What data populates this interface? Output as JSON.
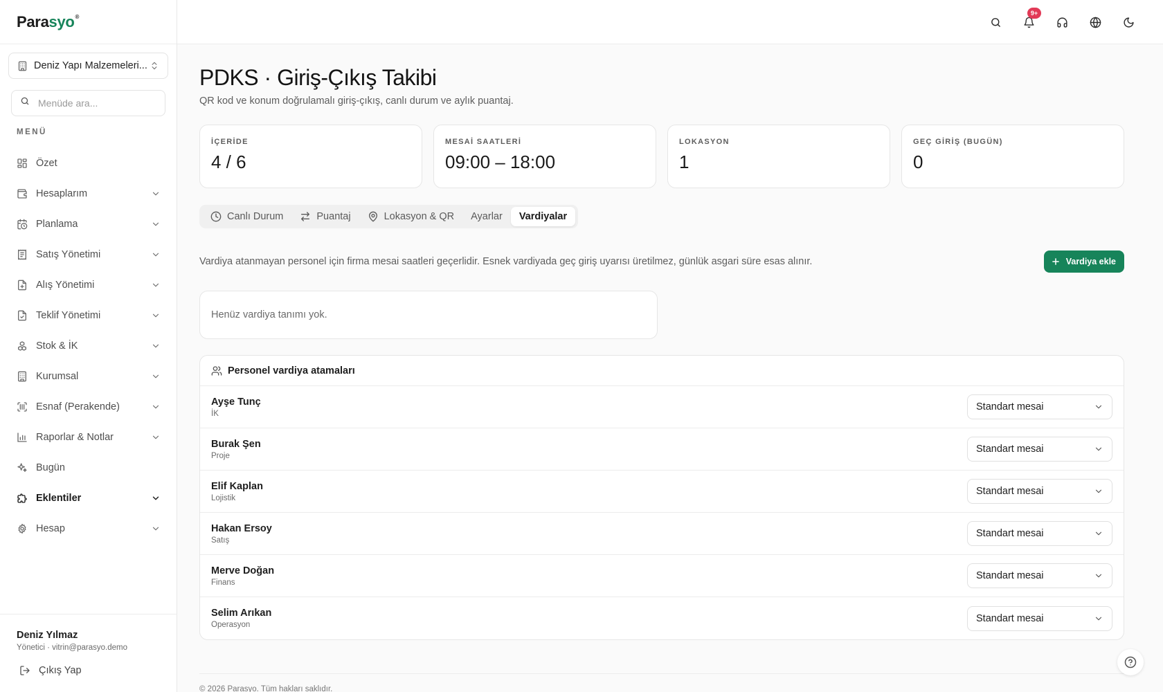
{
  "brand": {
    "logo_main": "Para",
    "logo_accent": "syo",
    "logo_mark": "®"
  },
  "sidebar": {
    "company": "Deniz Yapı Malzemeleri...",
    "search_placeholder": "Menüde ara...",
    "menu_title": "MENÜ",
    "items": [
      {
        "label": "Özet",
        "icon": "dashboard-icon",
        "has_children": false
      },
      {
        "label": "Hesaplarım",
        "icon": "wallet-icon",
        "has_children": true
      },
      {
        "label": "Planlama",
        "icon": "calendar-clock-icon",
        "has_children": true
      },
      {
        "label": "Satış Yönetimi",
        "icon": "receipt-icon",
        "has_children": true
      },
      {
        "label": "Alış Yönetimi",
        "icon": "file-plus-icon",
        "has_children": true
      },
      {
        "label": "Teklif Yönetimi",
        "icon": "file-check-icon",
        "has_children": true
      },
      {
        "label": "Stok & İK",
        "icon": "boxes-icon",
        "has_children": true
      },
      {
        "label": "Kurumsal",
        "icon": "building-icon",
        "has_children": true
      },
      {
        "label": "Esnaf (Perakende)",
        "icon": "barcode-scan-icon",
        "has_children": true
      },
      {
        "label": "Raporlar & Notlar",
        "icon": "bar-chart-icon",
        "has_children": true
      },
      {
        "label": "Bugün",
        "icon": "sparkles-icon",
        "has_children": false
      },
      {
        "label": "Eklentiler",
        "icon": "puzzle-icon",
        "has_children": true,
        "active": true
      },
      {
        "label": "Hesap",
        "icon": "gear-icon",
        "has_children": true
      }
    ],
    "user": {
      "name": "Deniz Yılmaz",
      "role": "Yönetici · vitrin@parasyo.demo"
    },
    "logout_label": "Çıkış Yap"
  },
  "topbar": {
    "notification_badge": "9+"
  },
  "page": {
    "title": "PDKS · Giriş-Çıkış Takibi",
    "subtitle": "QR kod ve konum doğrulamalı giriş-çıkış, canlı durum ve aylık puantaj."
  },
  "stats": [
    {
      "label": "İÇERİDE",
      "value": "4 / 6"
    },
    {
      "label": "MESAİ SAATLERİ",
      "value": "09:00 – 18:00"
    },
    {
      "label": "LOKASYON",
      "value": "1"
    },
    {
      "label": "GEÇ GİRİŞ (BUGÜN)",
      "value": "0"
    }
  ],
  "tabs": [
    {
      "label": "Canlı Durum",
      "icon": "clock-icon"
    },
    {
      "label": "Puantaj",
      "icon": "arrows-swap-icon"
    },
    {
      "label": "Lokasyon & QR",
      "icon": "map-pin-icon"
    },
    {
      "label": "Ayarlar"
    },
    {
      "label": "Vardiyalar",
      "active": true
    }
  ],
  "shifts": {
    "info": "Vardiya atanmayan personel için firma mesai saatleri geçerlidir. Esnek vardiyada geç giriş uyarısı üretilmez, günlük asgari süre esas alınır.",
    "add_label": "Vardiya ekle",
    "empty_text": "Henüz vardiya tanımı yok."
  },
  "assignments": {
    "title": "Personel vardiya atamaları",
    "rows": [
      {
        "name": "Ayşe Tunç",
        "dept": "İK",
        "shift": "Standart mesai"
      },
      {
        "name": "Burak Şen",
        "dept": "Proje",
        "shift": "Standart mesai"
      },
      {
        "name": "Elif Kaplan",
        "dept": "Lojistik",
        "shift": "Standart mesai"
      },
      {
        "name": "Hakan Ersoy",
        "dept": "Satış",
        "shift": "Standart mesai"
      },
      {
        "name": "Merve Doğan",
        "dept": "Finans",
        "shift": "Standart mesai"
      },
      {
        "name": "Selim Arıkan",
        "dept": "Operasyon",
        "shift": "Standart mesai"
      }
    ]
  },
  "footer": "© 2026 Parasyo. Tüm hakları saklıdır.",
  "colors": {
    "accent": "#17845a",
    "badge": "#e23a57"
  }
}
